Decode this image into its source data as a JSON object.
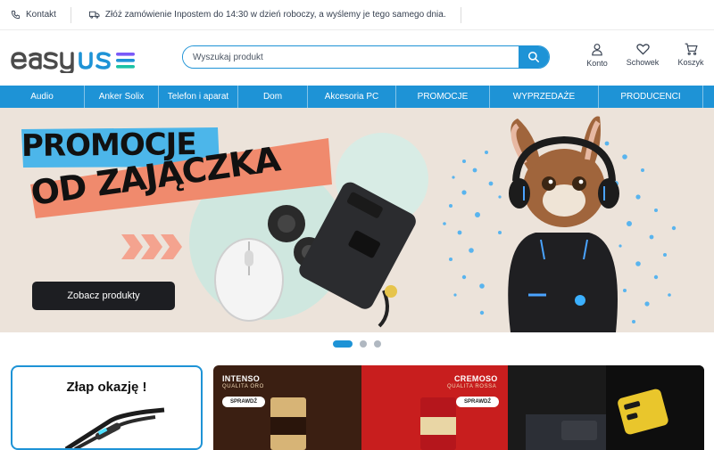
{
  "topbar": {
    "contact_label": "Kontakt",
    "promo_text": "Złóż zamówienie Inpostem do 14:30 w dzień roboczy, a wyślemy je tego samego dnia."
  },
  "header": {
    "logo_text": "easyuse",
    "search_placeholder": "Wyszukaj produkt",
    "account_label": "Konto",
    "wishlist_label": "Schowek",
    "cart_label": "Koszyk"
  },
  "nav": {
    "items": [
      {
        "label": "Audio"
      },
      {
        "label": "Anker Solix"
      },
      {
        "label": "Telefon i aparat"
      },
      {
        "label": "Dom"
      },
      {
        "label": "Akcesoria PC"
      },
      {
        "label": "PROMOCJE"
      },
      {
        "label": "WYPRZEDAŻE"
      },
      {
        "label": "PRODUCENCI"
      }
    ]
  },
  "hero": {
    "headline_line1": "PROMOCJE",
    "headline_line2": "OD ZAJĄCZKA",
    "cta_label": "Zobacz produkty",
    "slide_count": 3,
    "active_slide": 1
  },
  "tiles": {
    "offer_title": "Złap okazję !",
    "coffee_left_brand": "INTENSO",
    "coffee_left_sub": "QUALITA ORO",
    "coffee_left_check": "SPRAWDŹ",
    "coffee_right_brand": "CREMOSO",
    "coffee_right_sub": "QUALITA ROSSA",
    "coffee_right_check": "SPRAWDŹ"
  },
  "colors": {
    "accent": "#1e93d6",
    "hero_bg": "#ece3da",
    "highlight_blue": "#4cb6ea",
    "highlight_salmon": "#f08a6d",
    "coffee_dark": "#3b1f12",
    "coffee_red": "#c81e1e",
    "charger_yellow": "#e9c62c"
  }
}
